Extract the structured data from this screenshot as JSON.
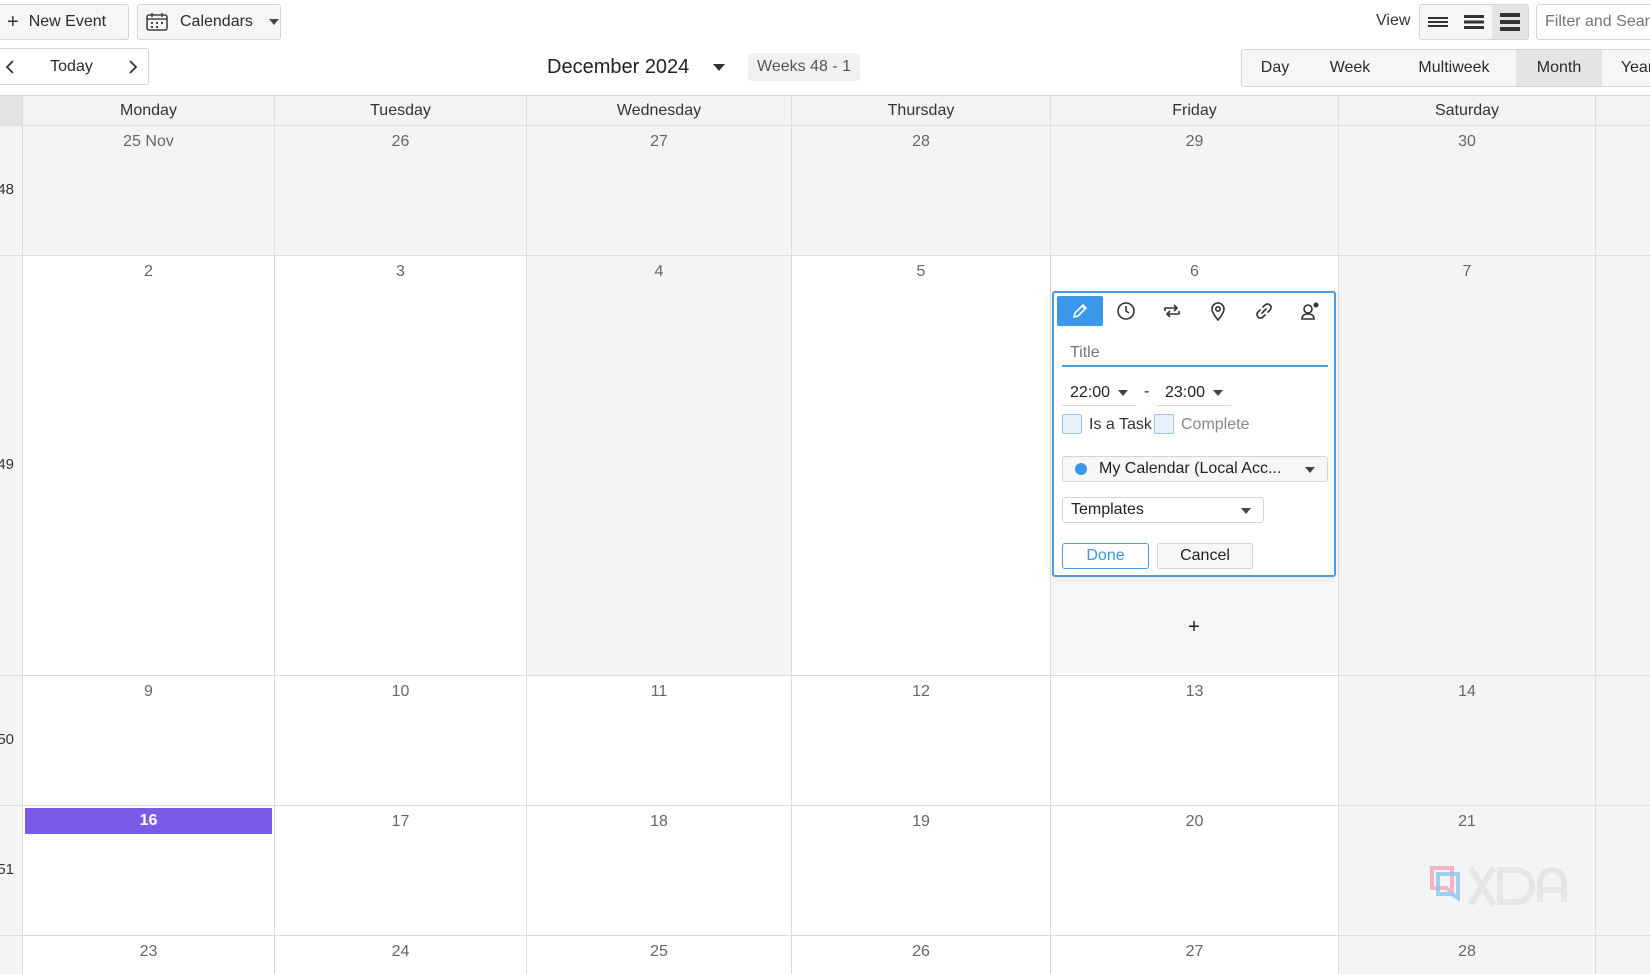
{
  "toolbar": {
    "new_event_label": "New Event",
    "calendars_label": "Calendars",
    "view_label": "View",
    "search_placeholder": "Filter and Search"
  },
  "navigation": {
    "today_label": "Today",
    "month_title": "December 2024",
    "weeks_badge": "Weeks 48 - 1",
    "ranges": [
      "Day",
      "Week",
      "Multiweek",
      "Month",
      "Year"
    ],
    "active_range": "Month"
  },
  "calendar": {
    "weekdays": [
      "Monday",
      "Tuesday",
      "Wednesday",
      "Thursday",
      "Friday",
      "Saturday"
    ],
    "weeks": [
      {
        "number": "48",
        "days": [
          "25 Nov",
          "26",
          "27",
          "28",
          "29",
          "30"
        ]
      },
      {
        "number": "49",
        "days": [
          "2",
          "3",
          "4",
          "5",
          "6",
          "7"
        ]
      },
      {
        "number": "50",
        "days": [
          "9",
          "10",
          "11",
          "12",
          "13",
          "14"
        ]
      },
      {
        "number": "51",
        "days": [
          "16",
          "17",
          "18",
          "19",
          "20",
          "21"
        ]
      },
      {
        "number": "",
        "days": [
          "23",
          "24",
          "25",
          "26",
          "27",
          "28"
        ]
      }
    ],
    "today": "16",
    "add_symbol": "+"
  },
  "popover": {
    "title_placeholder": "Title",
    "start_time": "22:00",
    "end_time": "23:00",
    "separator": "-",
    "is_task_label": "Is a Task",
    "complete_label": "Complete",
    "calendar_label": "My Calendar (Local Acc...",
    "calendar_color": "#3b97e8",
    "templates_label": "Templates",
    "done_label": "Done",
    "cancel_label": "Cancel"
  },
  "colors": {
    "accent": "#3b97e8",
    "today": "#7b5be6"
  }
}
